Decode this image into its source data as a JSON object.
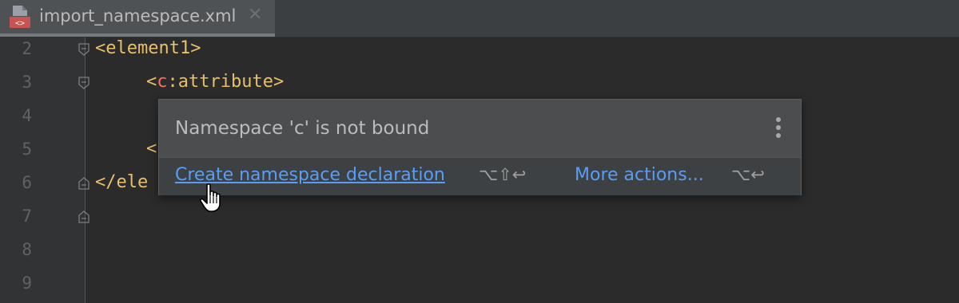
{
  "tab": {
    "file_name": "import_namespace.xml",
    "close_glyph": "✕",
    "icon": "xml-file-icon"
  },
  "gutter": {
    "line_numbers": [
      "2",
      "3",
      "4",
      "5",
      "6",
      "7",
      "8",
      "9"
    ]
  },
  "code": {
    "line2": "<element1>",
    "line3_open": "<",
    "line3_ns": "c",
    "line3_rest": ":attribute>",
    "line5_fragment": "<",
    "line6_fragment": "</ele"
  },
  "popup": {
    "message": "Namespace 'c' is not bound",
    "menu_icon": "kebab-menu-icon",
    "primary_action": "Create namespace declaration",
    "primary_shortcut": "⌥⇧↩",
    "secondary_action": "More actions...",
    "secondary_shortcut": "⌥↩"
  },
  "colors": {
    "editor_bg": "#2b2b2b",
    "link": "#589df6",
    "tag": "#e8bf6a",
    "error_ns": "#ff6b68"
  }
}
